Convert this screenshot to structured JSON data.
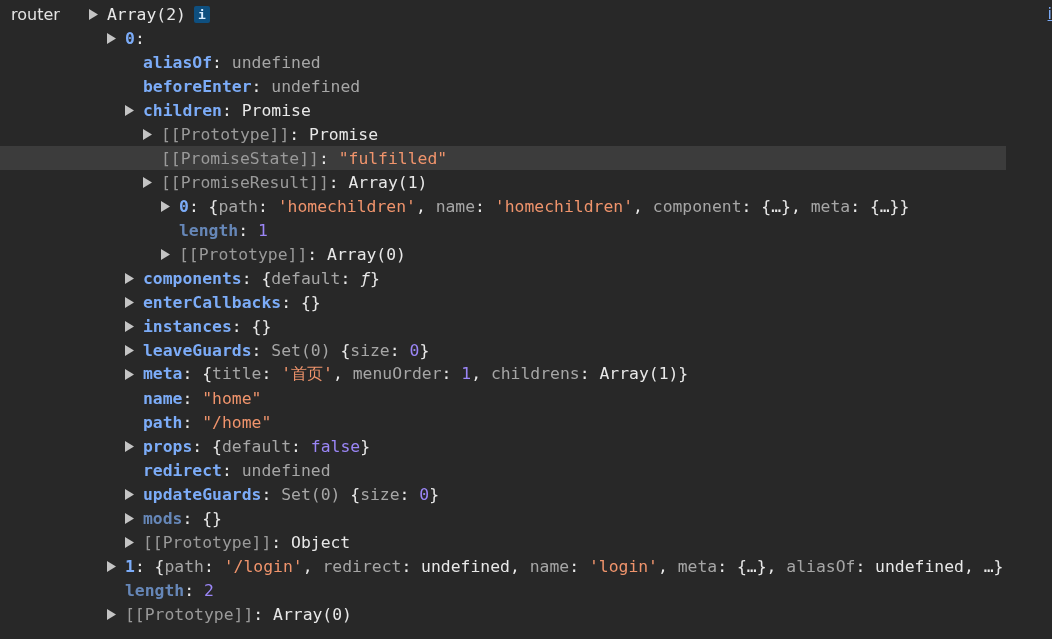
{
  "console": {
    "label": "router",
    "link": "i",
    "tree": {
      "expandable": true,
      "selected": false,
      "badge": "i",
      "segments": [
        {
          "kind": "plain",
          "text": "Array(2)"
        }
      ],
      "children": [
        {
          "expandable": true,
          "selected": false,
          "segments": [
            {
              "kind": "key",
              "text": "0"
            },
            {
              "kind": "plain",
              "text": ":"
            }
          ],
          "children": [
            {
              "expandable": false,
              "selected": false,
              "segments": [
                {
                  "kind": "key",
                  "text": "aliasOf"
                },
                {
                  "kind": "plain",
                  "text": ": "
                },
                {
                  "kind": "dim",
                  "text": "undefined"
                }
              ]
            },
            {
              "expandable": false,
              "selected": false,
              "segments": [
                {
                  "kind": "key",
                  "text": "beforeEnter"
                },
                {
                  "kind": "plain",
                  "text": ": "
                },
                {
                  "kind": "dim",
                  "text": "undefined"
                }
              ]
            },
            {
              "expandable": true,
              "selected": false,
              "segments": [
                {
                  "kind": "key",
                  "text": "children"
                },
                {
                  "kind": "plain",
                  "text": ": Promise"
                }
              ],
              "children": [
                {
                  "expandable": true,
                  "selected": false,
                  "segments": [
                    {
                      "kind": "internal",
                      "text": "[[Prototype]]"
                    },
                    {
                      "kind": "plain",
                      "text": ": Promise"
                    }
                  ]
                },
                {
                  "expandable": false,
                  "selected": true,
                  "segments": [
                    {
                      "kind": "internal",
                      "text": "[[PromiseState]]"
                    },
                    {
                      "kind": "plain",
                      "text": ": "
                    },
                    {
                      "kind": "string",
                      "text": "\"fulfilled\""
                    }
                  ]
                },
                {
                  "expandable": true,
                  "selected": false,
                  "segments": [
                    {
                      "kind": "internal",
                      "text": "[[PromiseResult]]"
                    },
                    {
                      "kind": "plain",
                      "text": ": Array(1)"
                    }
                  ],
                  "children": [
                    {
                      "expandable": true,
                      "selected": false,
                      "segments": [
                        {
                          "kind": "key",
                          "text": "0"
                        },
                        {
                          "kind": "plain",
                          "text": ": {"
                        },
                        {
                          "kind": "dim",
                          "text": "path"
                        },
                        {
                          "kind": "plain",
                          "text": ": "
                        },
                        {
                          "kind": "string",
                          "text": "'homechildren'"
                        },
                        {
                          "kind": "plain",
                          "text": ", "
                        },
                        {
                          "kind": "dim",
                          "text": "name"
                        },
                        {
                          "kind": "plain",
                          "text": ": "
                        },
                        {
                          "kind": "string",
                          "text": "'homechildren'"
                        },
                        {
                          "kind": "plain",
                          "text": ", "
                        },
                        {
                          "kind": "dim",
                          "text": "component"
                        },
                        {
                          "kind": "plain",
                          "text": ": {…}, "
                        },
                        {
                          "kind": "dim",
                          "text": "meta"
                        },
                        {
                          "kind": "plain",
                          "text": ": {…}}"
                        }
                      ]
                    },
                    {
                      "expandable": false,
                      "selected": false,
                      "segments": [
                        {
                          "kind": "key-dim",
                          "text": "length"
                        },
                        {
                          "kind": "plain",
                          "text": ": "
                        },
                        {
                          "kind": "number",
                          "text": "1"
                        }
                      ]
                    },
                    {
                      "expandable": true,
                      "selected": false,
                      "segments": [
                        {
                          "kind": "internal",
                          "text": "[[Prototype]]"
                        },
                        {
                          "kind": "plain",
                          "text": ": Array(0)"
                        }
                      ]
                    }
                  ]
                }
              ]
            },
            {
              "expandable": true,
              "selected": false,
              "segments": [
                {
                  "kind": "key",
                  "text": "components"
                },
                {
                  "kind": "plain",
                  "text": ": {"
                },
                {
                  "kind": "dim",
                  "text": "default"
                },
                {
                  "kind": "plain",
                  "text": ": "
                },
                {
                  "kind": "func",
                  "text": "ƒ"
                },
                {
                  "kind": "plain",
                  "text": "}"
                }
              ]
            },
            {
              "expandable": true,
              "selected": false,
              "segments": [
                {
                  "kind": "key",
                  "text": "enterCallbacks"
                },
                {
                  "kind": "plain",
                  "text": ": {}"
                }
              ]
            },
            {
              "expandable": true,
              "selected": false,
              "segments": [
                {
                  "kind": "key",
                  "text": "instances"
                },
                {
                  "kind": "plain",
                  "text": ": {}"
                }
              ]
            },
            {
              "expandable": true,
              "selected": false,
              "segments": [
                {
                  "kind": "key",
                  "text": "leaveGuards"
                },
                {
                  "kind": "plain",
                  "text": ": "
                },
                {
                  "kind": "dim",
                  "text": "Set(0) "
                },
                {
                  "kind": "plain",
                  "text": "{"
                },
                {
                  "kind": "dim",
                  "text": "size"
                },
                {
                  "kind": "plain",
                  "text": ": "
                },
                {
                  "kind": "number",
                  "text": "0"
                },
                {
                  "kind": "plain",
                  "text": "}"
                }
              ]
            },
            {
              "expandable": true,
              "selected": false,
              "segments": [
                {
                  "kind": "key",
                  "text": "meta"
                },
                {
                  "kind": "plain",
                  "text": ": {"
                },
                {
                  "kind": "dim",
                  "text": "title"
                },
                {
                  "kind": "plain",
                  "text": ": "
                },
                {
                  "kind": "string",
                  "text": "'首页'"
                },
                {
                  "kind": "plain",
                  "text": ", "
                },
                {
                  "kind": "dim",
                  "text": "menuOrder"
                },
                {
                  "kind": "plain",
                  "text": ": "
                },
                {
                  "kind": "number",
                  "text": "1"
                },
                {
                  "kind": "plain",
                  "text": ", "
                },
                {
                  "kind": "dim",
                  "text": "childrens"
                },
                {
                  "kind": "plain",
                  "text": ": Array(1)}"
                }
              ]
            },
            {
              "expandable": false,
              "selected": false,
              "segments": [
                {
                  "kind": "key",
                  "text": "name"
                },
                {
                  "kind": "plain",
                  "text": ": "
                },
                {
                  "kind": "string",
                  "text": "\"home\""
                }
              ]
            },
            {
              "expandable": false,
              "selected": false,
              "segments": [
                {
                  "kind": "key",
                  "text": "path"
                },
                {
                  "kind": "plain",
                  "text": ": "
                },
                {
                  "kind": "string",
                  "text": "\"/home\""
                }
              ]
            },
            {
              "expandable": true,
              "selected": false,
              "segments": [
                {
                  "kind": "key",
                  "text": "props"
                },
                {
                  "kind": "plain",
                  "text": ": {"
                },
                {
                  "kind": "dim",
                  "text": "default"
                },
                {
                  "kind": "plain",
                  "text": ": "
                },
                {
                  "kind": "number",
                  "text": "false"
                },
                {
                  "kind": "plain",
                  "text": "}"
                }
              ]
            },
            {
              "expandable": false,
              "selected": false,
              "segments": [
                {
                  "kind": "key",
                  "text": "redirect"
                },
                {
                  "kind": "plain",
                  "text": ": "
                },
                {
                  "kind": "dim",
                  "text": "undefined"
                }
              ]
            },
            {
              "expandable": true,
              "selected": false,
              "segments": [
                {
                  "kind": "key",
                  "text": "updateGuards"
                },
                {
                  "kind": "plain",
                  "text": ": "
                },
                {
                  "kind": "dim",
                  "text": "Set(0) "
                },
                {
                  "kind": "plain",
                  "text": "{"
                },
                {
                  "kind": "dim",
                  "text": "size"
                },
                {
                  "kind": "plain",
                  "text": ": "
                },
                {
                  "kind": "number",
                  "text": "0"
                },
                {
                  "kind": "plain",
                  "text": "}"
                }
              ]
            },
            {
              "expandable": true,
              "selected": false,
              "segments": [
                {
                  "kind": "key-dim",
                  "text": "mods"
                },
                {
                  "kind": "plain",
                  "text": ": {}"
                }
              ]
            },
            {
              "expandable": true,
              "selected": false,
              "segments": [
                {
                  "kind": "internal",
                  "text": "[[Prototype]]"
                },
                {
                  "kind": "plain",
                  "text": ": Object"
                }
              ]
            }
          ]
        },
        {
          "expandable": true,
          "selected": false,
          "segments": [
            {
              "kind": "key",
              "text": "1"
            },
            {
              "kind": "plain",
              "text": ": {"
            },
            {
              "kind": "dim",
              "text": "path"
            },
            {
              "kind": "plain",
              "text": ": "
            },
            {
              "kind": "string",
              "text": "'/login'"
            },
            {
              "kind": "plain",
              "text": ", "
            },
            {
              "kind": "dim",
              "text": "redirect"
            },
            {
              "kind": "plain",
              "text": ": undefined, "
            },
            {
              "kind": "dim",
              "text": "name"
            },
            {
              "kind": "plain",
              "text": ": "
            },
            {
              "kind": "string",
              "text": "'login'"
            },
            {
              "kind": "plain",
              "text": ", "
            },
            {
              "kind": "dim",
              "text": "meta"
            },
            {
              "kind": "plain",
              "text": ": {…}, "
            },
            {
              "kind": "dim",
              "text": "aliasOf"
            },
            {
              "kind": "plain",
              "text": ": undefined, …}"
            }
          ]
        },
        {
          "expandable": false,
          "selected": false,
          "segments": [
            {
              "kind": "key-dim",
              "text": "length"
            },
            {
              "kind": "plain",
              "text": ": "
            },
            {
              "kind": "number",
              "text": "2"
            }
          ]
        },
        {
          "expandable": true,
          "selected": false,
          "segments": [
            {
              "kind": "internal",
              "text": "[[Prototype]]"
            },
            {
              "kind": "plain",
              "text": ": Array(0)"
            }
          ]
        }
      ]
    }
  }
}
